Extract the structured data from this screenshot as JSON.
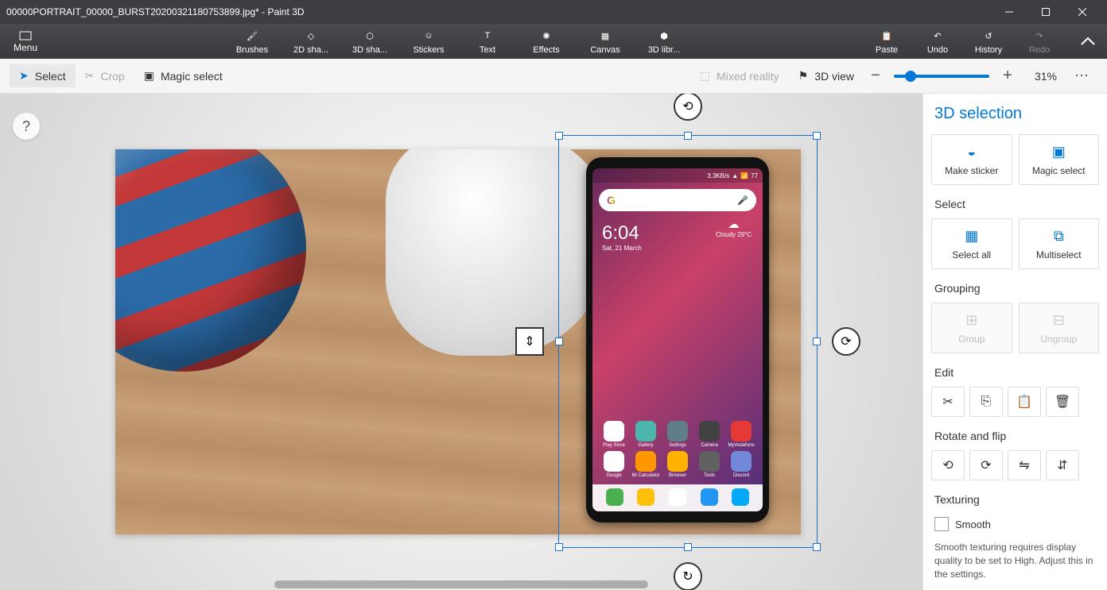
{
  "window": {
    "title": "00000PORTRAIT_00000_BURST20200321180753899.jpg* - Paint 3D"
  },
  "ribbon": {
    "menu": "Menu",
    "tools": {
      "brushes": "Brushes",
      "shapes2d": "2D sha...",
      "shapes3d": "3D sha...",
      "stickers": "Stickers",
      "text": "Text",
      "effects": "Effects",
      "canvas": "Canvas",
      "library3d": "3D libr..."
    },
    "right": {
      "paste": "Paste",
      "undo": "Undo",
      "history": "History",
      "redo": "Redo"
    }
  },
  "subbar": {
    "select": "Select",
    "crop": "Crop",
    "magic_select": "Magic select",
    "mixed_reality": "Mixed reality",
    "view3d": "3D view",
    "zoom": "31%"
  },
  "help": "?",
  "phone": {
    "status": {
      "speed": "3.3KB/s",
      "battery": "77"
    },
    "clock": {
      "time": "6:04",
      "date": "Sat, 21 March"
    },
    "weather": {
      "cond": "Cloudy",
      "temp": "29°C"
    },
    "search_letter": "G",
    "apps": [
      {
        "n": "Play Store",
        "c": "#ffffff"
      },
      {
        "n": "Gallery",
        "c": "#4db6ac"
      },
      {
        "n": "Settings",
        "c": "#607d8b"
      },
      {
        "n": "Camera",
        "c": "#424242"
      },
      {
        "n": "MyVodafone",
        "c": "#e53935"
      },
      {
        "n": "Google",
        "c": "#ffffff"
      },
      {
        "n": "Mi Calculator",
        "c": "#ff9800"
      },
      {
        "n": "Browser",
        "c": "#ffb300"
      },
      {
        "n": "Tools",
        "c": "#616161"
      },
      {
        "n": "Discord",
        "c": "#7289da"
      }
    ],
    "dock": [
      {
        "c": "#4caf50"
      },
      {
        "c": "#ffc107"
      },
      {
        "c": "#fff"
      },
      {
        "c": "#2196f3"
      },
      {
        "c": "#03a9f4"
      }
    ]
  },
  "panel": {
    "title": "3D selection",
    "make_sticker": "Make sticker",
    "magic_select": "Magic select",
    "section_select": "Select",
    "select_all": "Select all",
    "multiselect": "Multiselect",
    "section_grouping": "Grouping",
    "group": "Group",
    "ungroup": "Ungroup",
    "section_edit": "Edit",
    "section_rotate": "Rotate and flip",
    "section_texturing": "Texturing",
    "smooth": "Smooth",
    "hint": "Smooth texturing requires display quality to be set to High. Adjust this in the settings."
  }
}
